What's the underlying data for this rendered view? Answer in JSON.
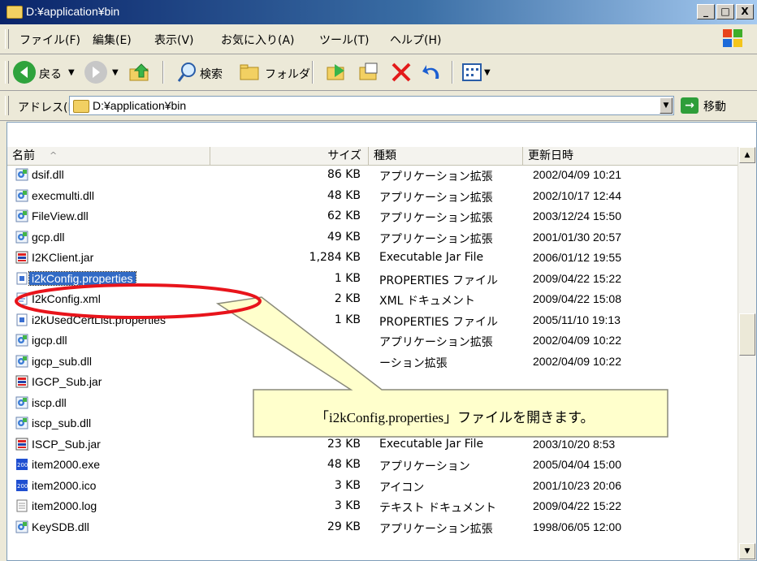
{
  "window": {
    "title": "D:¥application¥bin",
    "buttons": [
      "_",
      "□",
      "X"
    ]
  },
  "menu": [
    "ファイル(F)",
    "編集(E)",
    "表示(V)",
    "お気に入り(A)",
    "ツール(T)",
    "ヘルプ(H)"
  ],
  "toolbar": {
    "back_label": "戻る",
    "search_label": "検索",
    "folders_label": "フォルダ"
  },
  "address": {
    "label": "アドレス(D)",
    "value": "D:¥application¥bin",
    "go_label": "移動"
  },
  "columns": {
    "name": "名前",
    "sort_indicator": "^",
    "size": "サイズ",
    "type": "種類",
    "modified": "更新日時"
  },
  "files": [
    {
      "name": "dsif.dll",
      "size": "86 KB",
      "type": "アプリケーション拡張",
      "modified": "2002/04/09 10:21",
      "icon": "dll-icon"
    },
    {
      "name": "execmulti.dll",
      "size": "48 KB",
      "type": "アプリケーション拡張",
      "modified": "2002/10/17 12:44",
      "icon": "dll-icon"
    },
    {
      "name": "FileView.dll",
      "size": "62 KB",
      "type": "アプリケーション拡張",
      "modified": "2003/12/24 15:50",
      "icon": "dll-icon"
    },
    {
      "name": "gcp.dll",
      "size": "49 KB",
      "type": "アプリケーション拡張",
      "modified": "2001/01/30 20:57",
      "icon": "dll-icon"
    },
    {
      "name": "I2KClient.jar",
      "size": "1,284 KB",
      "type": "Executable Jar File",
      "modified": "2006/01/12 19:55",
      "icon": "jar-icon"
    },
    {
      "name": "i2kConfig.properties",
      "size": "1 KB",
      "type": "PROPERTIES ファイル",
      "modified": "2009/04/22 15:22",
      "icon": "properties-icon",
      "selected": true
    },
    {
      "name": "I2kConfig.xml",
      "size": "2 KB",
      "type": "XML ドキュメント",
      "modified": "2009/04/22 15:08",
      "icon": "xml-icon"
    },
    {
      "name": "i2kUsedCertList.properties",
      "size": "1 KB",
      "type": "PROPERTIES ファイル",
      "modified": "2005/11/10 19:13",
      "icon": "properties-icon"
    },
    {
      "name": "igcp.dll",
      "size": "",
      "type": "アプリケーション拡張",
      "modified": "2002/04/09 10:22",
      "icon": "dll-icon"
    },
    {
      "name": "igcp_sub.dll",
      "size": "",
      "type": "ーション拡張",
      "modified": "2002/04/09 10:22",
      "icon": "dll-icon"
    },
    {
      "name": "IGCP_Sub.jar",
      "size": "",
      "type": "",
      "modified": "",
      "icon": "jar-icon"
    },
    {
      "name": "iscp.dll",
      "size": "",
      "type": "",
      "modified": "",
      "icon": "dll-icon"
    },
    {
      "name": "iscp_sub.dll",
      "size": "",
      "type": "",
      "modified": "",
      "icon": "dll-icon"
    },
    {
      "name": "ISCP_Sub.jar",
      "size": "23 KB",
      "type": "Executable Jar File",
      "modified": "2003/10/20 8:53",
      "icon": "jar-icon"
    },
    {
      "name": "item2000.exe",
      "size": "48 KB",
      "type": "アプリケーション",
      "modified": "2005/04/04 15:00",
      "icon": "exe-icon"
    },
    {
      "name": "item2000.ico",
      "size": "3 KB",
      "type": "アイコン",
      "modified": "2001/10/23 20:06",
      "icon": "ico-icon"
    },
    {
      "name": "item2000.log",
      "size": "3 KB",
      "type": "テキスト ドキュメント",
      "modified": "2009/04/22 15:22",
      "icon": "log-icon"
    },
    {
      "name": "KeySDB.dll",
      "size": "29 KB",
      "type": "アプリケーション拡張",
      "modified": "1998/06/05 12:00",
      "icon": "dll-icon"
    }
  ],
  "callout": {
    "text": "「i2kConfig.properties」ファイルを開きます。"
  },
  "colors": {
    "selection": "#316ac5",
    "callout_fill": "#ffffcc",
    "highlight_ring": "#e8141b"
  }
}
